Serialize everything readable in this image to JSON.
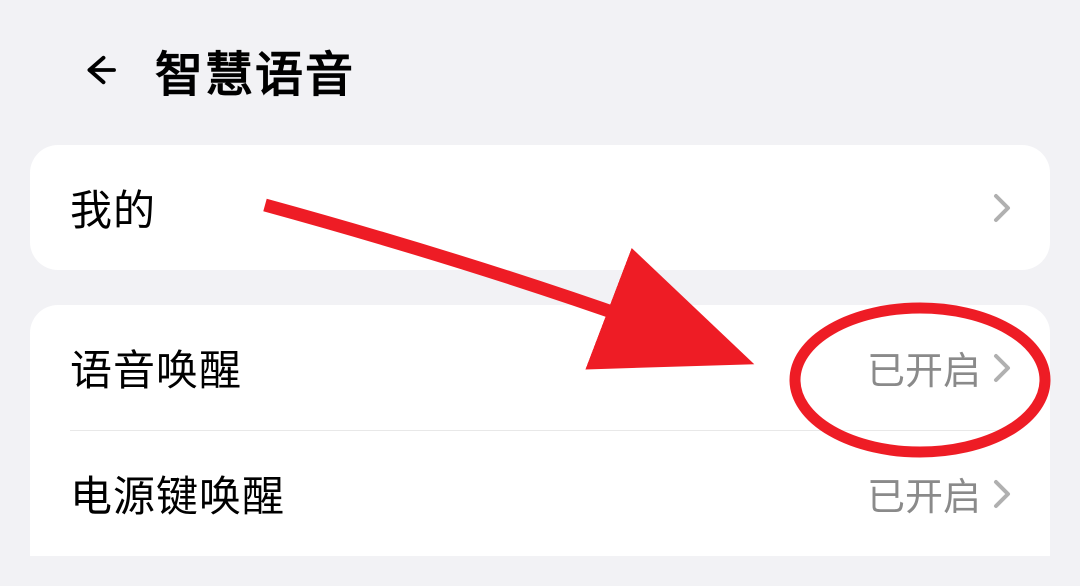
{
  "header": {
    "title": "智慧语音"
  },
  "card1": {
    "row1": {
      "label": "我的"
    }
  },
  "card2": {
    "row1": {
      "label": "语音唤醒",
      "value": "已开启"
    },
    "row2": {
      "label": "电源键唤醒",
      "value": "已开启"
    }
  },
  "annotation": {
    "color": "#ee1c25"
  }
}
